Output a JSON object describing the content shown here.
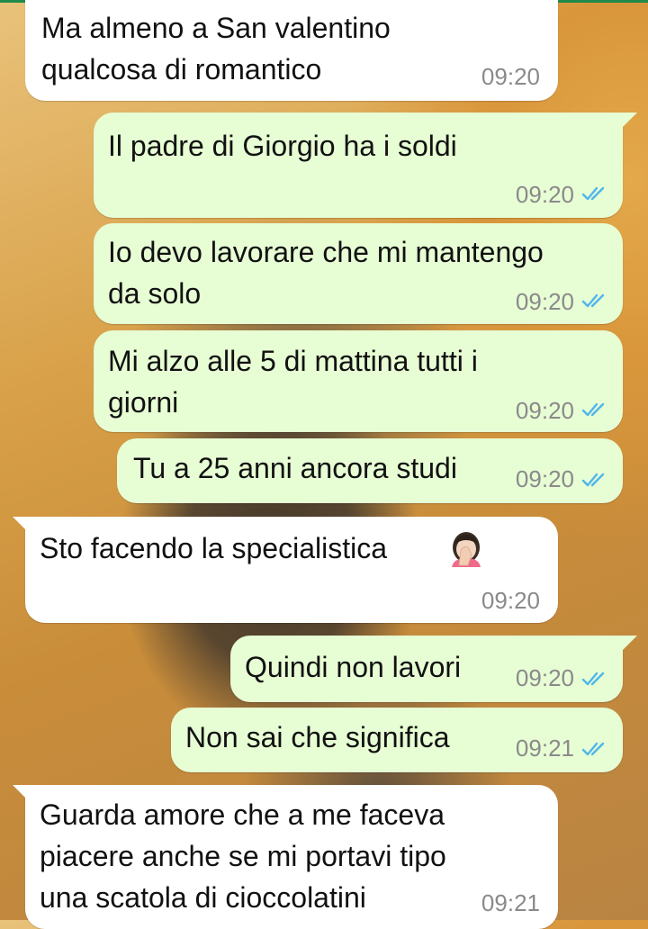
{
  "colors": {
    "incoming_bubble": "#ffffff",
    "outgoing_bubble": "#e7fdd4",
    "read_ticks": "#4fb6ec",
    "timestamp": "#8a8a8a"
  },
  "messages": [
    {
      "direction": "incoming",
      "text": "Ma almeno a San valentino\nqualcosa di romantico",
      "time": "09:20"
    },
    {
      "direction": "outgoing",
      "text": "Il padre di Giorgio ha i soldi",
      "time": "09:20",
      "status": "read-ticks-icon"
    },
    {
      "direction": "outgoing",
      "text": "Io devo lavorare che mi mantengo\nda solo",
      "time": "09:20",
      "status": "read-ticks-icon"
    },
    {
      "direction": "outgoing",
      "text": "Mi alzo alle 5 di mattina tutti i\ngiorni",
      "time": "09:20",
      "status": "read-ticks-icon"
    },
    {
      "direction": "outgoing",
      "text": "Tu a 25 anni ancora studi",
      "time": "09:20",
      "status": "read-ticks-icon"
    },
    {
      "direction": "incoming",
      "text": "Sto facendo la specialistica",
      "emoji": "woman-facepalming-icon",
      "time": "09:20"
    },
    {
      "direction": "outgoing",
      "text": "Quindi non lavori",
      "time": "09:20",
      "status": "read-ticks-icon"
    },
    {
      "direction": "outgoing",
      "text": "Non sai che significa",
      "time": "09:21",
      "status": "read-ticks-icon"
    },
    {
      "direction": "incoming",
      "text": "Guarda amore che a me faceva\npiacere anche se mi portavi tipo\nuna scatola di cioccolatini",
      "time": "09:21"
    }
  ]
}
